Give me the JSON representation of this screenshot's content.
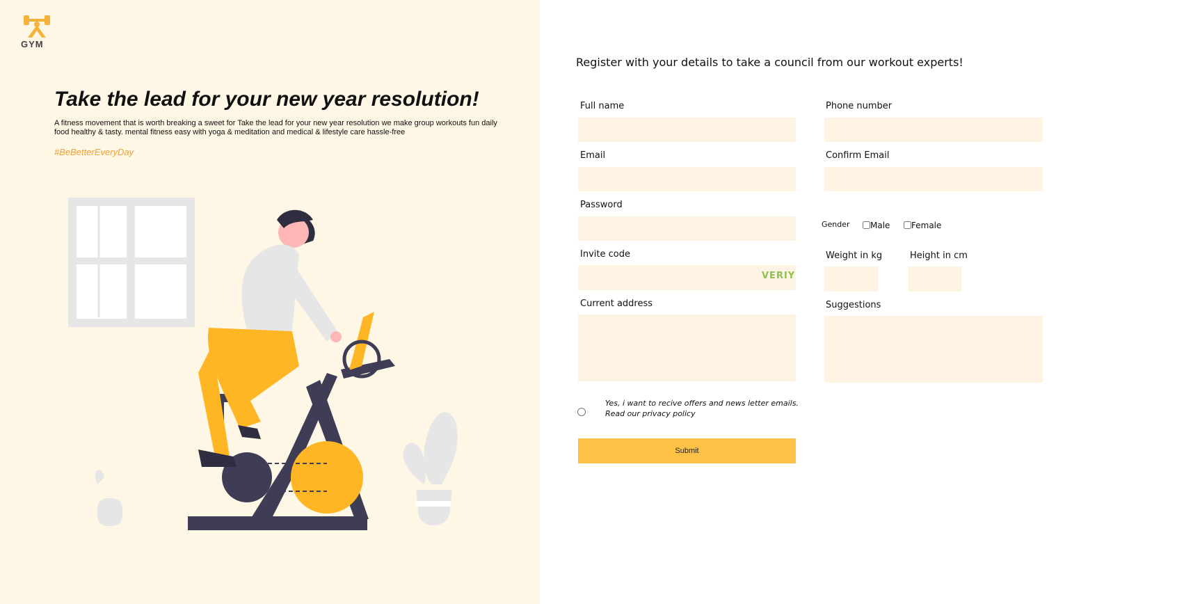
{
  "brand": {
    "logo_text": "GYM",
    "logo_icon": "dumbbell-icon",
    "accent": "#ffc246"
  },
  "hero": {
    "headline": "Take the lead for your new year resolution!",
    "description": "A fitness movement that is worth breaking a sweet for Take the lead for your new year resolution we make group workouts fun daily food healthy & tasty. mental fitness easy with yoga & meditation and medical & lifestyle care hassle-free",
    "hashtag": "#BeBetterEveryDay",
    "illustration": "person-on-exercise-bike-illustration"
  },
  "form": {
    "title": "Register with your details to take a council from our workout experts!",
    "full_name_label": "Full name",
    "phone_label": "Phone number",
    "email_label": "Email",
    "confirm_email_label": "Confirm Email",
    "password_label": "Password",
    "gender_label": "Gender",
    "gender_options": [
      "Male",
      "Female"
    ],
    "invite_label": "Invite code",
    "verify_label": "VERIY",
    "weight_label": "Weight in kg",
    "height_label": "Height in cm",
    "address_label": "Current address",
    "suggestions_label": "Suggestions",
    "consent_line1": "Yes, i want to recive offers and news letter emails.",
    "consent_line2": "Read our privacy policy",
    "submit_label": "Submit",
    "field_bg": "#fff3e4",
    "verify_color": "#8cc152"
  }
}
